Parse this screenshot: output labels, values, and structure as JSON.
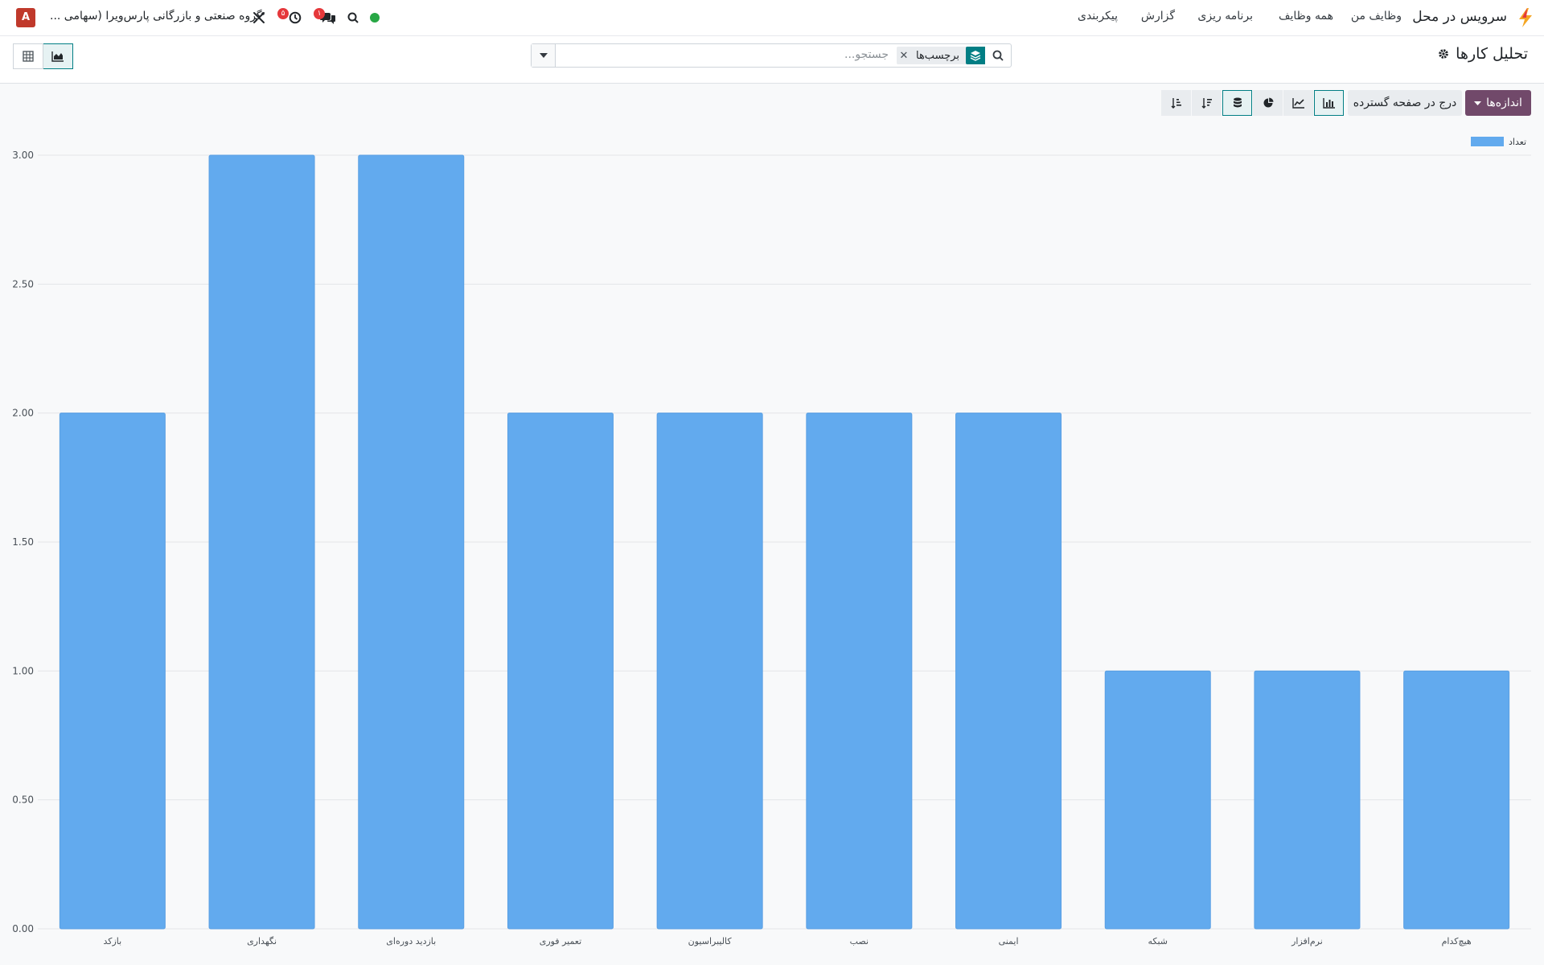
{
  "topbar": {
    "app_name": "سرویس در محل",
    "menus": [
      "وظایف من",
      "همه وظایف",
      "برنامه ریزی",
      "گزارش",
      "پیکربندی"
    ],
    "company": "گروه صنعتی و بازرگانی پارس‌ویرا (سهامی ...",
    "avatar_letter": "A",
    "activity_badge": "۵",
    "messages_badge": "۱",
    "status_color": "#28a745",
    "icons": [
      "lightning-logo-icon",
      "status-dot-icon",
      "search-icon",
      "messages-icon",
      "activity-clock-icon",
      "debug-tools-icon"
    ]
  },
  "control": {
    "page_title": "تحلیل کارها",
    "search_facet": "برچسب‌ها",
    "search_placeholder": "جستجو..."
  },
  "toolbar": {
    "measures_label": "اندازه‌ها",
    "insert_label": "درج در صفحه گسترده"
  },
  "colors": {
    "accent": "#017e84",
    "primary": "#71496a",
    "bar": "#62aaee"
  },
  "chart_data": {
    "type": "bar",
    "categories": [
      "بازکد",
      "نگهداری",
      "بازدید دوره‌ای",
      "تعمیر فوری",
      "کالیبراسیون",
      "نصب",
      "ایمنی",
      "شبکه",
      "نرم‌افزار",
      "هیچ‌کدام"
    ],
    "series": [
      {
        "name": "تعداد",
        "values": [
          2,
          3,
          3,
          2,
          2,
          2,
          2,
          1,
          1,
          1
        ]
      }
    ],
    "ylim": [
      0,
      3
    ],
    "yticks": [
      "0.00",
      "0.50",
      "1.00",
      "1.50",
      "2.00",
      "2.50",
      "3.00"
    ],
    "grid": true,
    "legend": "top-right"
  }
}
